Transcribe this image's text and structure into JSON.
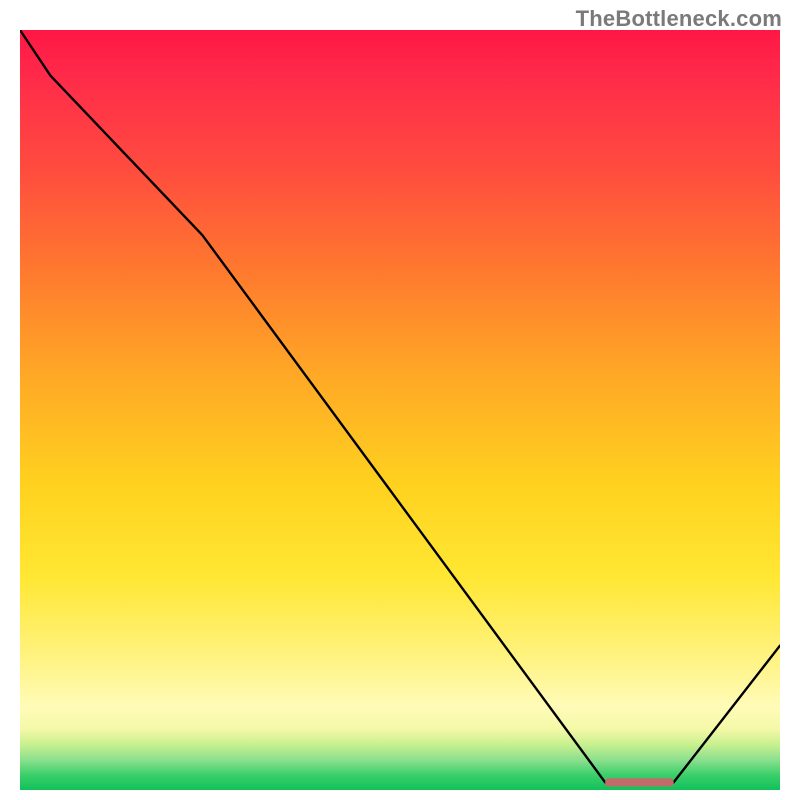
{
  "watermark": "TheBottleneck.com",
  "chart_data": {
    "type": "line",
    "title": "",
    "xlabel": "",
    "ylabel": "",
    "xlim": [
      0,
      100
    ],
    "ylim": [
      0,
      100
    ],
    "grid": false,
    "series": [
      {
        "name": "curve",
        "x": [
          0,
          4,
          24,
          77,
          86,
          100
        ],
        "y": [
          100,
          94,
          73,
          1,
          1,
          19
        ]
      }
    ],
    "marker": {
      "name": "optimal-range",
      "x0": 77,
      "x1": 86,
      "y": 1,
      "color": "#c46a6a"
    },
    "background_gradient": {
      "direction": "vertical",
      "stops": [
        {
          "pos": 0,
          "color": "#ff1744"
        },
        {
          "pos": 18,
          "color": "#ff4b3f"
        },
        {
          "pos": 45,
          "color": "#ffa726"
        },
        {
          "pos": 72,
          "color": "#ffe733"
        },
        {
          "pos": 89,
          "color": "#fffbb8"
        },
        {
          "pos": 96,
          "color": "#8de08e"
        },
        {
          "pos": 100,
          "color": "#11c15a"
        }
      ]
    }
  }
}
